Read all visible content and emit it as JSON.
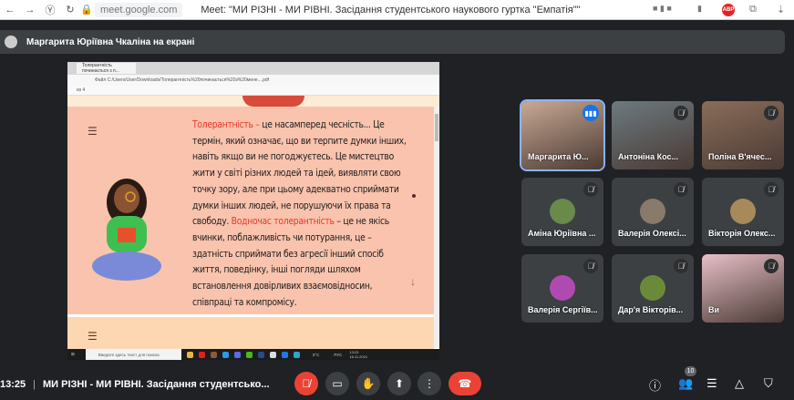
{
  "browser": {
    "url": "meet.google.com",
    "title": "Meet: \"МИ РІЗНІ - МИ РІВНІ. Засідання студентського наукового гуртка \"Емпатія\"\""
  },
  "presenting_banner": "Маргарита Юріївна Чкаліна на екрані",
  "shared_screen": {
    "tab_title": "Толерантність починається з п...",
    "address": "Файл   C:/Users/User/Downloads/Толерантність%20починається%20з%20мене....pdf",
    "page_indicator": "из 4",
    "slide_text": [
      {
        "t": "Толерантність – ",
        "red": true
      },
      {
        "t": "це насамперед  чесність... Це термін, який означає, що ви терпите думки інших, навіть якщо ви не погоджуєтесь. Це мистецтво жити у світі різних людей та ідей, виявляти свою точку зору, але при цьому адекватно сприймати думки інших людей, не порушуючи їх права та свободу.  ",
        "red": false
      },
      {
        "t": "Водночас  толерантність",
        "red": true
      },
      {
        "t": " – це не якісь вчинки, поблажливість чи потурання, це – здатність сприймати без агресії інший спосіб життя, поведінку, інші погляди шляхом встановлення довірливих взаємовідносин, співпраці та компромісу.",
        "red": false
      }
    ],
    "taskbar": {
      "search_placeholder": "Введите здесь текст для поиска",
      "temp": "3°C",
      "lang": "РУС",
      "time": "13:23",
      "date": "16.11.2021"
    }
  },
  "participants": [
    {
      "name": "Маргарита Ю...",
      "video": true,
      "speaking": true,
      "color": "#c9a994"
    },
    {
      "name": "Антоніна Кос...",
      "video": true,
      "muted": true,
      "color": "#6c7a80"
    },
    {
      "name": "Поліна В'ячес...",
      "video": true,
      "muted": true,
      "color": "#8a6d5a"
    },
    {
      "name": "Аміна Юріївна ...",
      "muted": true,
      "color": "#6a8a4a"
    },
    {
      "name": "Валерія Олексі...",
      "muted": true,
      "color": "#8a7a6a"
    },
    {
      "name": "Вікторія Олекс...",
      "muted": true,
      "color": "#a88a5a"
    },
    {
      "name": "Валерія Сергіїв...",
      "muted": true,
      "color": "#b04ab0"
    },
    {
      "name": "Дар'я Вікторів...",
      "muted": true,
      "color": "#6a8a3a"
    },
    {
      "name": "Ви",
      "video": true,
      "muted": true,
      "color": "#e8c0c8"
    }
  ],
  "bottom_bar": {
    "time": "13:25",
    "separator": "|",
    "meeting_title": "МИ РІЗНІ - МИ РІВНІ. Засідання студентсько...",
    "participant_count": "10"
  },
  "colors": {
    "accent": "#1a73e8",
    "end_call": "#ea4335",
    "background": "#202124"
  }
}
